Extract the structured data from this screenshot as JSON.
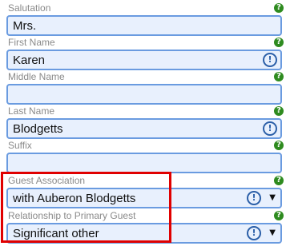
{
  "form": {
    "help_glyph": "?",
    "warn_glyph": "!",
    "caret_glyph": "▼",
    "fields": [
      {
        "label": "Salutation",
        "value": ""
      },
      {
        "label": "First Name",
        "value": "Karen"
      },
      {
        "label": "Middle Name",
        "value": ""
      },
      {
        "label": "Last Name",
        "value": "Blodgetts"
      },
      {
        "label": "Suffix",
        "value": ""
      },
      {
        "label": "Guest Association",
        "value": "with Auberon Blodgetts"
      },
      {
        "label": "Relationship to Primary Guest",
        "value": "Significant other"
      }
    ],
    "salutation_value": "Mrs."
  },
  "colors": {
    "input_bg": "#e8f0fd",
    "input_border": "#6a9be0",
    "help_badge": "#2e8b1f",
    "warn_icon": "#2b5fa8",
    "highlight": "#e00000"
  }
}
